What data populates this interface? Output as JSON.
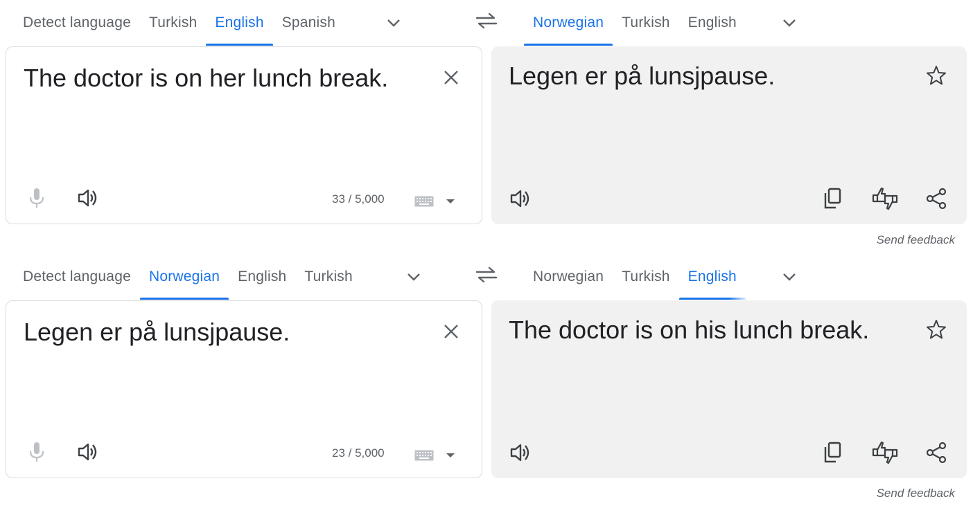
{
  "panels": [
    {
      "source_tabs": [
        {
          "label": "Detect language"
        },
        {
          "label": "Turkish"
        },
        {
          "label": "English"
        },
        {
          "label": "Spanish"
        }
      ],
      "source_selected": "English",
      "target_tabs": [
        {
          "label": "Norwegian"
        },
        {
          "label": "Turkish"
        },
        {
          "label": "English"
        }
      ],
      "target_selected": "Norwegian",
      "source_text": "The doctor is on her lunch break.",
      "char_count": "33 / 5,000",
      "translation": "Legen er på lunsjpause.",
      "feedback_label": "Send feedback"
    },
    {
      "source_tabs": [
        {
          "label": "Detect language"
        },
        {
          "label": "Norwegian"
        },
        {
          "label": "English"
        },
        {
          "label": "Turkish"
        }
      ],
      "source_selected": "Norwegian",
      "target_tabs": [
        {
          "label": "Norwegian"
        },
        {
          "label": "Turkish"
        },
        {
          "label": "English"
        }
      ],
      "target_selected": "English",
      "source_text": "Legen er på lunsjpause.",
      "char_count": "23 / 5,000",
      "translation": "The doctor is on his lunch break.",
      "feedback_label": "Send feedback"
    }
  ],
  "icons": [
    "chevron-down-icon",
    "swap-languages-icon",
    "close-icon",
    "microphone-icon",
    "speaker-icon",
    "keyboard-icon",
    "star-icon",
    "copy-icon",
    "rate-translation-icon",
    "share-icon"
  ],
  "colors": {
    "accent": "#1a73e8",
    "text": "#202124",
    "muted": "#5f6368",
    "target_bg": "#f1f1f1"
  }
}
